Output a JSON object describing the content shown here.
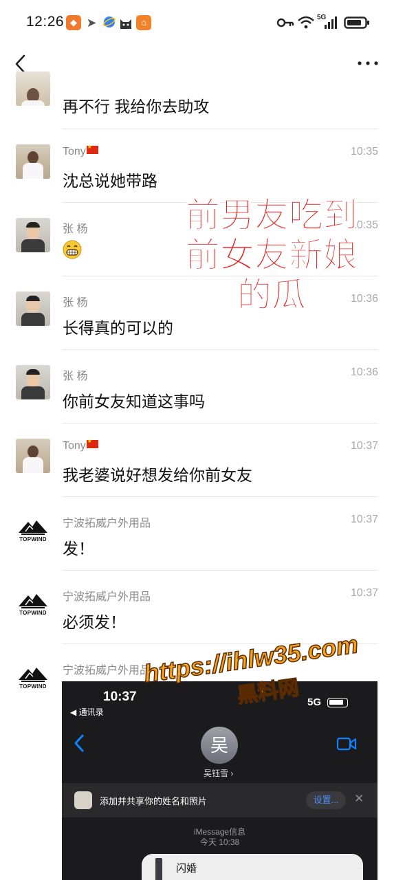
{
  "status_bar": {
    "time": "12:26",
    "network": "5G"
  },
  "nav": {
    "back_icon": "chevron-left-icon",
    "more_icon": "more-horizontal-icon"
  },
  "messages": [
    {
      "sender": "",
      "time": "",
      "text": "再不行 我给你去助攻"
    },
    {
      "sender": "Tony",
      "time": "10:35",
      "text": "沈总说她带路"
    },
    {
      "sender": "张 杨",
      "time": "10:35",
      "text": "😁"
    },
    {
      "sender": "张 杨",
      "time": "10:36",
      "text": "长得真的可以的"
    },
    {
      "sender": "张 杨",
      "time": "10:36",
      "text": "你前女友知道这事吗"
    },
    {
      "sender": "Tony",
      "time": "10:37",
      "text": "我老婆说好想发给你前女友"
    },
    {
      "sender": "宁波拓威户外用品",
      "time": "10:37",
      "text": "发！"
    },
    {
      "sender": "宁波拓威户外用品",
      "time": "10:37",
      "text": "必须发！"
    },
    {
      "sender": "宁波拓威户外用品",
      "time": "",
      "text": ""
    }
  ],
  "overlay": {
    "line1": "前男友吃到",
    "line2": "前女友新娘",
    "line3": "的瓜"
  },
  "topwind_logo_text": "TOPWIND",
  "screenshot": {
    "time": "10:37",
    "back_label": "◀ 通讯录",
    "network": "5G",
    "avatar_char": "吴",
    "contact_name": "吴钰雪 ›",
    "banner_text": "添加并共享你的姓名和照片",
    "settings_label": "设置...",
    "close_label": "✕",
    "imessage_label": "iMessage信息",
    "date_label": "今天 10:38",
    "bubble_text": "闪婚"
  },
  "watermark": {
    "url": "https://ihlw35.com",
    "name": "黑料网"
  },
  "colors": {
    "overlay_red": "#e8231f",
    "watermark_orange": "#f5a21b",
    "ios_blue": "#0a84ff"
  }
}
